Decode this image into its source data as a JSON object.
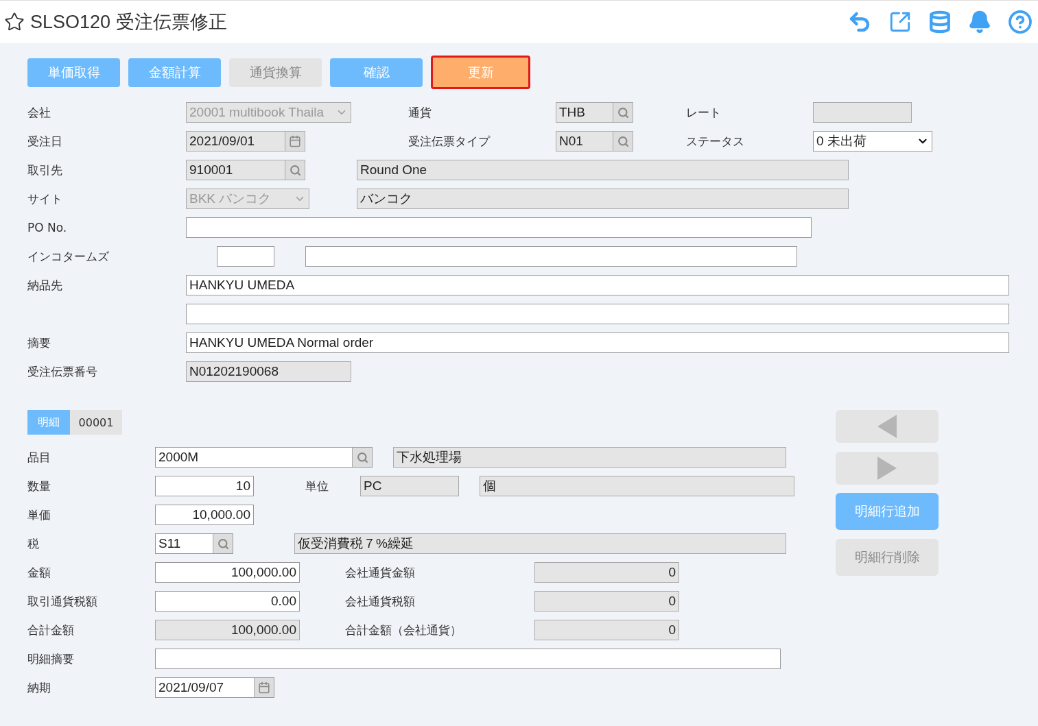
{
  "header": {
    "title": "SLSO120 受注伝票修正",
    "favorite": false
  },
  "toolbar": [
    {
      "label": "単価取得",
      "kind": "primary"
    },
    {
      "label": "金額計算",
      "kind": "primary"
    },
    {
      "label": "通貨換算",
      "kind": "disabled"
    },
    {
      "label": "確認",
      "kind": "primary"
    },
    {
      "label": "更新",
      "kind": "highlight"
    }
  ],
  "order_form": [
    {
      "label": "会社",
      "items": [
        {
          "kind": "select",
          "value": "20001 multibook Thaila",
          "readonly": true
        },
        {
          "kind": "label",
          "text": "通貨"
        },
        {
          "kind": "lookup",
          "value": "THB",
          "readonly": true
        },
        {
          "kind": "label",
          "text": "レート"
        },
        {
          "kind": "text",
          "readonly": true
        }
      ]
    },
    {
      "label": "受注日",
      "items": [
        {
          "kind": "date",
          "value": "2021/09/01",
          "readonly": true
        },
        {
          "kind": "label",
          "text": "受注伝票タイプ"
        },
        {
          "kind": "lookup",
          "value": "N01",
          "readonly": true
        },
        {
          "kind": "label",
          "text": "ステータス"
        },
        {
          "kind": "select",
          "value": "0 未出荷",
          "readonly": false
        }
      ]
    },
    {
      "label": "取引先",
      "items": [
        {
          "kind": "lookup",
          "value": "910001",
          "readonly": true
        },
        {
          "kind": "text",
          "value": "Round One",
          "readonly": true
        }
      ]
    },
    {
      "label": "サイト",
      "items": [
        {
          "kind": "select",
          "value": "BKK バンコク",
          "readonly": true
        },
        {
          "kind": "text",
          "value": "バンコク",
          "readonly": true
        }
      ]
    },
    {
      "label": "PO No.",
      "items": [
        {
          "kind": "text",
          "readonly": false
        }
      ]
    },
    {
      "label": "インコタームズ",
      "items": [
        {
          "kind": "text",
          "readonly": false
        },
        {
          "kind": "text",
          "readonly": false
        }
      ]
    },
    {
      "label": "納品先",
      "items": [
        {
          "kind": "text",
          "value": "HANKYU UMEDA",
          "readonly": false
        }
      ]
    },
    {
      "items": [
        {
          "kind": "text",
          "readonly": false
        }
      ]
    },
    {
      "label": "摘要",
      "items": [
        {
          "kind": "text",
          "value": "HANKYU UMEDA Normal order",
          "readonly": false
        }
      ]
    },
    {
      "label": "受注伝票番号",
      "items": [
        {
          "kind": "text",
          "value": "N01202190068",
          "readonly": true
        }
      ]
    }
  ],
  "detail_tabs": [
    {
      "label": "明細",
      "selected": true
    },
    {
      "label": "00001",
      "selected": false
    }
  ],
  "detail_form": [
    {
      "label": "品目",
      "items": [
        {
          "kind": "lookup",
          "value": "2000M",
          "readonly": false
        },
        {
          "kind": "text",
          "value": "下水処理場",
          "readonly": true
        }
      ]
    },
    {
      "label": "数量",
      "items": [
        {
          "kind": "number",
          "value": "10",
          "readonly": false
        },
        {
          "kind": "label",
          "text": "単位"
        },
        {
          "kind": "text",
          "value": "PC",
          "readonly": true
        },
        {
          "kind": "text",
          "value": "個",
          "readonly": true
        }
      ]
    },
    {
      "label": "単価",
      "items": [
        {
          "kind": "number",
          "value": "10,000.00",
          "readonly": false
        }
      ]
    },
    {
      "label": "税",
      "items": [
        {
          "kind": "lookup",
          "value": "S11",
          "readonly": false
        },
        {
          "kind": "text",
          "value": "仮受消費税７%繰延",
          "readonly": true
        }
      ]
    },
    {
      "label": "金額",
      "items": [
        {
          "kind": "number",
          "value": "100,000.00",
          "readonly": false
        },
        {
          "kind": "label",
          "text": "会社通貨金額"
        },
        {
          "kind": "number",
          "value": "0",
          "readonly": true
        }
      ]
    },
    {
      "label": "取引通貨税額",
      "items": [
        {
          "kind": "number",
          "value": "0.00",
          "readonly": false
        },
        {
          "kind": "label",
          "text": "会社通貨税額"
        },
        {
          "kind": "number",
          "value": "0",
          "readonly": true
        }
      ]
    },
    {
      "label": "合計金額",
      "items": [
        {
          "kind": "number",
          "value": "100,000.00",
          "readonly": true
        },
        {
          "kind": "label",
          "text": "合計金額（会社通貨）"
        },
        {
          "kind": "number",
          "value": "0",
          "readonly": true
        }
      ]
    },
    {
      "label": "明細摘要",
      "items": [
        {
          "kind": "text",
          "readonly": false
        }
      ]
    },
    {
      "label": "納期",
      "items": [
        {
          "kind": "date",
          "value": "2021/09/07",
          "readonly": false
        }
      ]
    }
  ],
  "detail_buttons": [
    {
      "kind": "prev",
      "disabled": true
    },
    {
      "kind": "next",
      "disabled": true
    },
    {
      "kind": "text",
      "label": "明細行追加",
      "disabled": false
    },
    {
      "kind": "text",
      "label": "明細行削除",
      "disabled": true
    }
  ]
}
